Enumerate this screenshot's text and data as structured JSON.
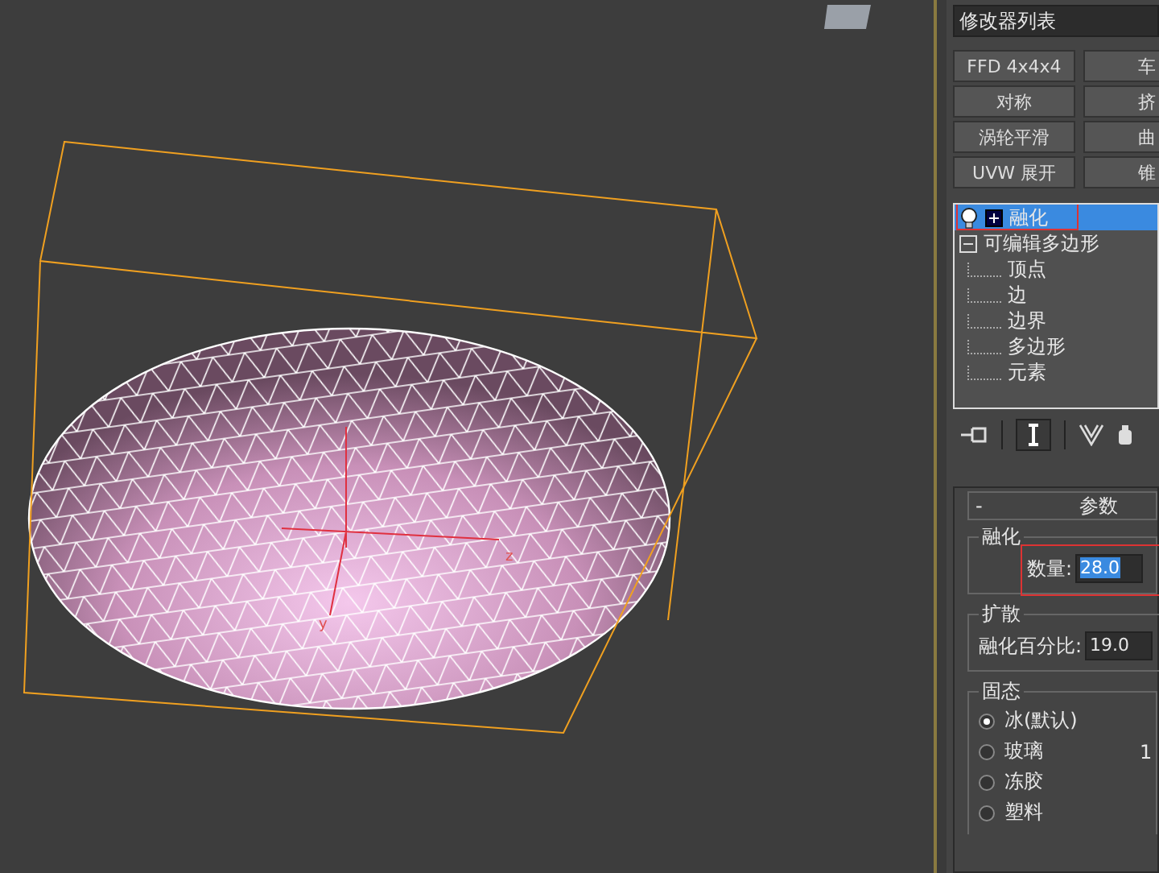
{
  "viewport": {
    "gizmo_labels": [
      {
        "text": "z",
        "kind": "z"
      },
      {
        "text": "y",
        "kind": "y"
      }
    ]
  },
  "modifier_panel": {
    "modifier_list": "修改器列表",
    "modifier_buttons": [
      [
        "FFD 4x4x4",
        "车"
      ],
      [
        "对称",
        "挤"
      ],
      [
        "涡轮平滑",
        "曲"
      ],
      [
        "UVW 展开",
        "锥"
      ]
    ],
    "stack": [
      {
        "label": "融化",
        "selected": true,
        "expanded": false,
        "kind": "modifier"
      },
      {
        "label": "可编辑多边形",
        "selected": false,
        "expanded": true,
        "kind": "object",
        "children": [
          {
            "label": "顶点",
            "selected": false
          },
          {
            "label": "边",
            "selected": false
          },
          {
            "label": "边界",
            "selected": false
          },
          {
            "label": "多边形",
            "selected": false
          },
          {
            "label": "元素",
            "selected": false
          }
        ]
      }
    ],
    "rollout": {
      "title": "参数",
      "collapse": "-",
      "melt": {
        "label": "融化",
        "amount_label": "数量:",
        "amount": "28.0"
      },
      "spread": {
        "label": "扩散",
        "percent_label": "融化百分比:",
        "percent": "19.0"
      },
      "solidity": {
        "label": "固态",
        "options": [
          {
            "label": "冰(默认)",
            "selected": true
          },
          {
            "label": "玻璃",
            "selected": false,
            "note": "1"
          },
          {
            "label": "冻胶",
            "selected": false
          },
          {
            "label": "塑料",
            "selected": false
          }
        ]
      }
    }
  }
}
